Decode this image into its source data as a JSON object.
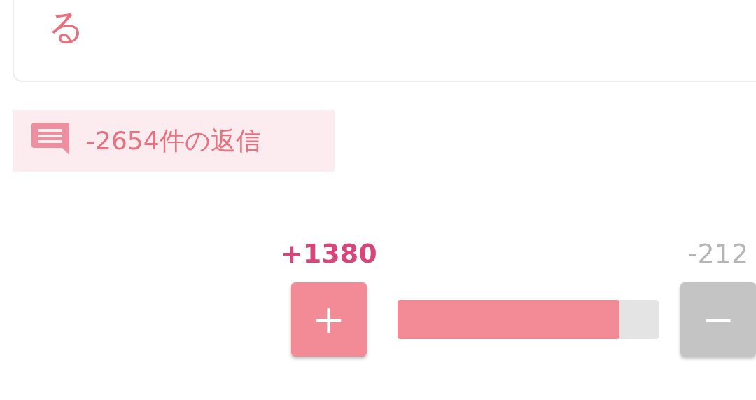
{
  "post": {
    "text": "る"
  },
  "replies": {
    "label": "-2654件の返信"
  },
  "vote": {
    "plus_count": "+1380",
    "plus_button": "+",
    "minus_count": "-212",
    "minus_button": "−",
    "level": 0.85
  }
}
